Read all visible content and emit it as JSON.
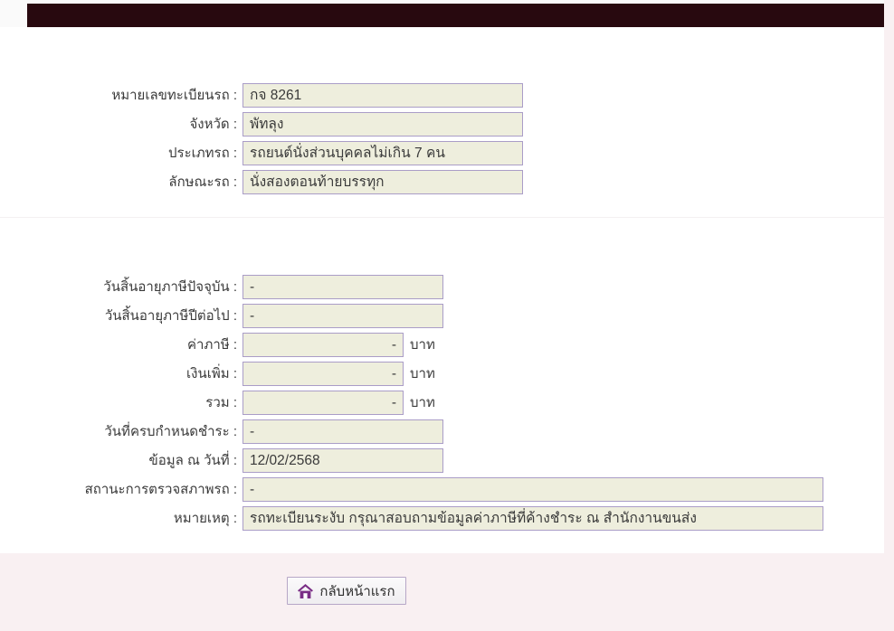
{
  "colors": {
    "top_bar": "#28090f",
    "band": "#f9f0f2",
    "field_bg": "#eeeedd",
    "field_border": "#aa9dc7",
    "accent": "#7a2e85"
  },
  "form": {
    "rows": [
      {
        "label": "หมายเลขทะเบียนรถ :",
        "value": "กจ 8261"
      },
      {
        "label": "จังหวัด :",
        "value": "พัทลุง"
      },
      {
        "label": "ประเภทรถ :",
        "value": "รถยนต์นั่งส่วนบุคคลไม่เกิน 7 คน"
      },
      {
        "label": "ลักษณะรถ :",
        "value": "นั่งสองตอนท้ายบรรทุก"
      },
      {
        "label": "วันสิ้นอายุภาษีปัจจุบัน :",
        "value": "-"
      },
      {
        "label": "วันสิ้นอายุภาษีปีต่อไป :",
        "value": "-"
      },
      {
        "label": "ค่าภาษี :",
        "value": "-",
        "suffix": "บาท"
      },
      {
        "label": "เงินเพิ่ม :",
        "value": "-",
        "suffix": "บาท"
      },
      {
        "label": "รวม :",
        "value": "-",
        "suffix": "บาท"
      },
      {
        "label": "วันที่ครบกำหนดชำระ :",
        "value": "-"
      },
      {
        "label": "ข้อมูล ณ วันที่ :",
        "value": "12/02/2568"
      },
      {
        "label": "สถานะการตรวจสภาพรถ :",
        "value": "-"
      },
      {
        "label": "หมายเหตุ :",
        "value": "รถทะเบียนระงับ กรุณาสอบถามข้อมูลค่าภาษีที่ค้างชำระ ณ สำนักงานขนส่ง"
      }
    ]
  },
  "footer": {
    "home_button_label": "กลับหน้าแรก"
  }
}
